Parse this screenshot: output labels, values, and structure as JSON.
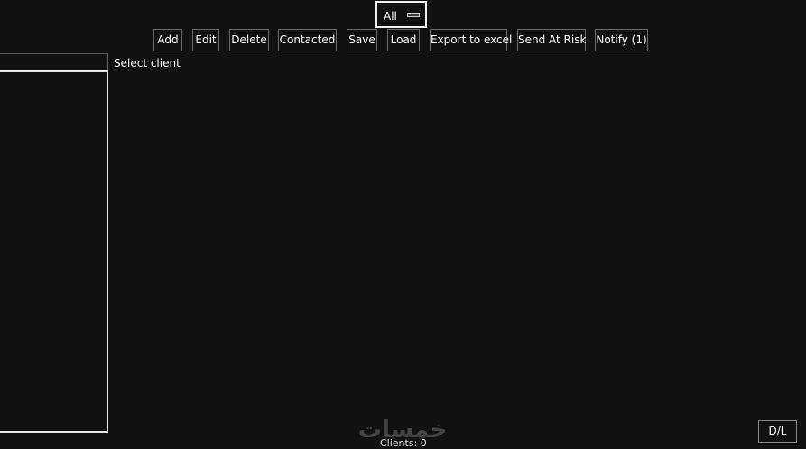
{
  "filter": {
    "selected": "All"
  },
  "toolbar": {
    "add": "Add",
    "edit": "Edit",
    "delete": "Delete",
    "contacted": "Contacted",
    "save": "Save",
    "load": "Load",
    "export": "Export to excel",
    "send_at_risk": "Send At Risk",
    "notify": "Notify (1)"
  },
  "main": {
    "select_client_label": "Select client"
  },
  "footer": {
    "clients_count": "Clients: 0",
    "dl_button": "D/L"
  },
  "watermark": {
    "text": "خمسات"
  }
}
